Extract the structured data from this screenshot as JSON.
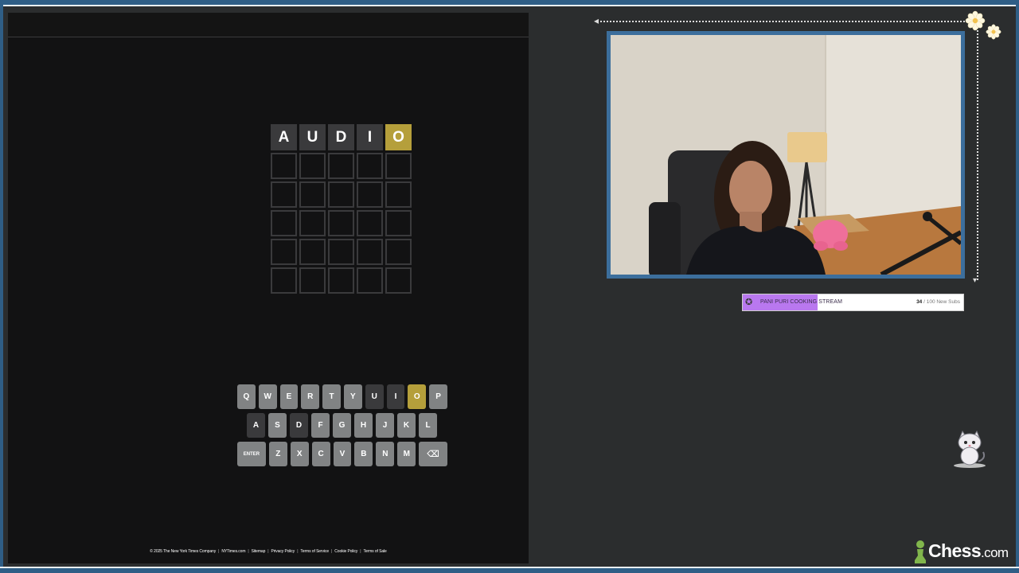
{
  "wordle": {
    "board": [
      [
        {
          "letter": "A",
          "state": "absent"
        },
        {
          "letter": "U",
          "state": "absent"
        },
        {
          "letter": "D",
          "state": "absent"
        },
        {
          "letter": "I",
          "state": "absent"
        },
        {
          "letter": "O",
          "state": "present"
        }
      ],
      [
        {
          "letter": "",
          "state": "empty"
        },
        {
          "letter": "",
          "state": "empty"
        },
        {
          "letter": "",
          "state": "empty"
        },
        {
          "letter": "",
          "state": "empty"
        },
        {
          "letter": "",
          "state": "empty"
        }
      ],
      [
        {
          "letter": "",
          "state": "empty"
        },
        {
          "letter": "",
          "state": "empty"
        },
        {
          "letter": "",
          "state": "empty"
        },
        {
          "letter": "",
          "state": "empty"
        },
        {
          "letter": "",
          "state": "empty"
        }
      ],
      [
        {
          "letter": "",
          "state": "empty"
        },
        {
          "letter": "",
          "state": "empty"
        },
        {
          "letter": "",
          "state": "empty"
        },
        {
          "letter": "",
          "state": "empty"
        },
        {
          "letter": "",
          "state": "empty"
        }
      ],
      [
        {
          "letter": "",
          "state": "empty"
        },
        {
          "letter": "",
          "state": "empty"
        },
        {
          "letter": "",
          "state": "empty"
        },
        {
          "letter": "",
          "state": "empty"
        },
        {
          "letter": "",
          "state": "empty"
        }
      ],
      [
        {
          "letter": "",
          "state": "empty"
        },
        {
          "letter": "",
          "state": "empty"
        },
        {
          "letter": "",
          "state": "empty"
        },
        {
          "letter": "",
          "state": "empty"
        },
        {
          "letter": "",
          "state": "empty"
        }
      ]
    ],
    "keyboard": [
      [
        {
          "label": "Q",
          "state": "unused"
        },
        {
          "label": "W",
          "state": "unused"
        },
        {
          "label": "E",
          "state": "unused"
        },
        {
          "label": "R",
          "state": "unused"
        },
        {
          "label": "T",
          "state": "unused"
        },
        {
          "label": "Y",
          "state": "unused"
        },
        {
          "label": "U",
          "state": "absent"
        },
        {
          "label": "I",
          "state": "absent"
        },
        {
          "label": "O",
          "state": "present"
        },
        {
          "label": "P",
          "state": "unused"
        }
      ],
      [
        {
          "label": "A",
          "state": "absent"
        },
        {
          "label": "S",
          "state": "unused"
        },
        {
          "label": "D",
          "state": "absent"
        },
        {
          "label": "F",
          "state": "unused"
        },
        {
          "label": "G",
          "state": "unused"
        },
        {
          "label": "H",
          "state": "unused"
        },
        {
          "label": "J",
          "state": "unused"
        },
        {
          "label": "K",
          "state": "unused"
        },
        {
          "label": "L",
          "state": "unused"
        }
      ],
      [
        {
          "label": "ENTER",
          "state": "unused",
          "wide": true
        },
        {
          "label": "Z",
          "state": "unused"
        },
        {
          "label": "X",
          "state": "unused"
        },
        {
          "label": "C",
          "state": "unused"
        },
        {
          "label": "V",
          "state": "unused"
        },
        {
          "label": "B",
          "state": "unused"
        },
        {
          "label": "N",
          "state": "unused"
        },
        {
          "label": "M",
          "state": "unused"
        },
        {
          "label": "⌫",
          "state": "unused",
          "wide": true,
          "icon": "backspace-icon"
        }
      ]
    ],
    "footer_links": [
      "© 2025 The New York Times Company",
      "NYTimes.com",
      "Sitemap",
      "Privacy Policy",
      "Terms of Service",
      "Cookie Policy",
      "Terms of Sale"
    ]
  },
  "stream": {
    "sub_goal": {
      "title": "PANI PURI COOKING STREAM",
      "current": "34",
      "target_text": " / 100 New Subs",
      "progress": 0.34
    },
    "logo": {
      "main": "Chess",
      "suffix": ".com"
    }
  },
  "colors": {
    "absent": "#3a3a3c",
    "present": "#b59f3b",
    "unused_key": "#818384",
    "frame": "#2f5e86",
    "progress": "#b978ef",
    "chess_green": "#81b64c"
  }
}
